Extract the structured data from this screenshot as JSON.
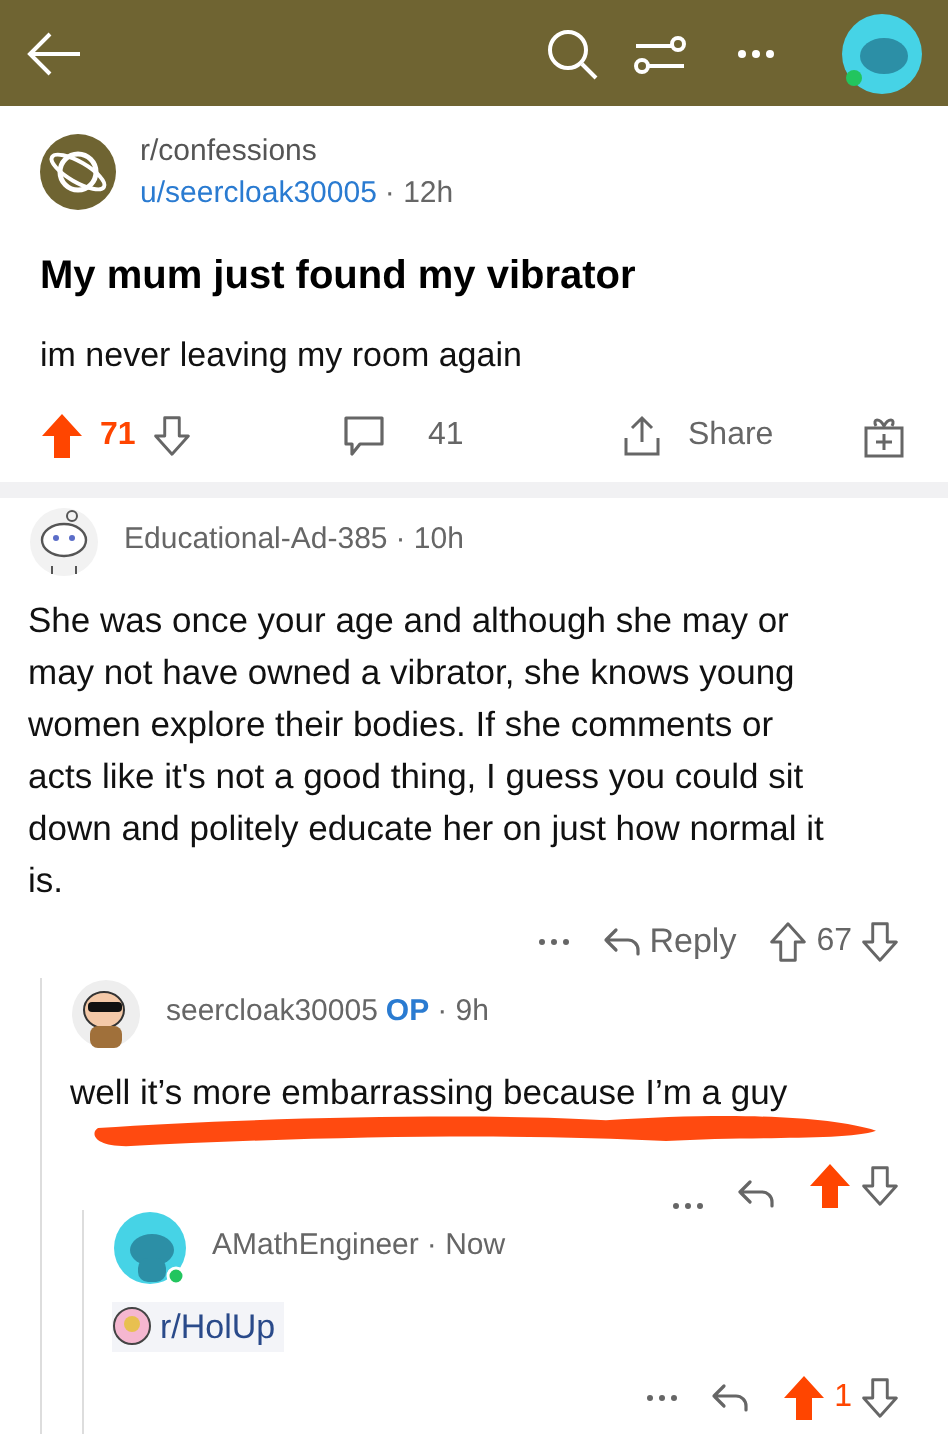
{
  "post": {
    "subreddit": "r/confessions",
    "author": "u/seercloak30005",
    "time": "· 12h",
    "title": "My mum just found my vibrator",
    "body": "im never leaving my room again",
    "score": "71",
    "upvoted": true,
    "comments_count": "41",
    "share_label": "Share"
  },
  "comments": [
    {
      "author": "Educational-Ad-385",
      "time": "· 10h",
      "body": "She was once your age and although she may or may not have owned a vibrator, she knows young women explore their bodies. If she comments or acts like it's not a good thing, I guess you could sit down and politely educate her on just how normal it is.",
      "reply_label": "Reply",
      "score": "67",
      "upvoted": false,
      "children": [
        {
          "author": "seercloak30005",
          "op_label": "OP",
          "time": "· 9h",
          "body": "well it’s more embarrassing because I’m a guy",
          "upvoted": true,
          "scribbled": true,
          "children": [
            {
              "author": "AMathEngineer",
              "online": true,
              "time": "· Now",
              "link": "r/HolUp",
              "score": "1",
              "upvoted": true
            }
          ]
        }
      ]
    }
  ]
}
